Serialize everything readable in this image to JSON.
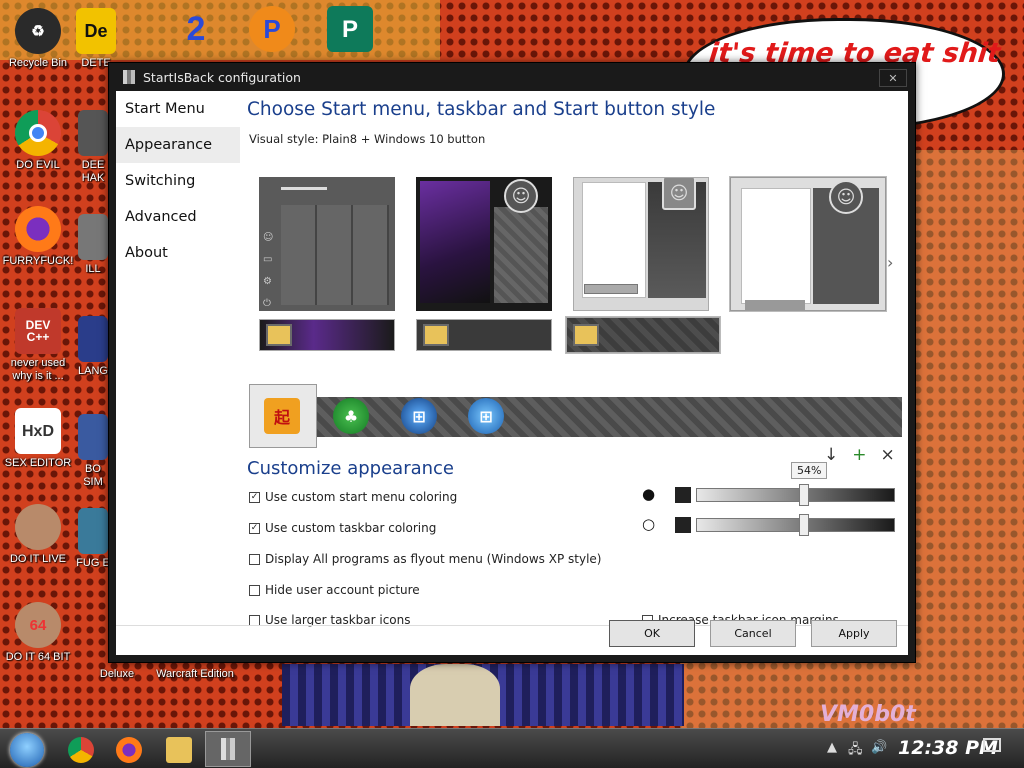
{
  "desktop": {
    "bubble_text": "it's time to eat shit ... ew",
    "signature": "VM0b0t",
    "icons": [
      {
        "label": "Recycle Bin"
      },
      {
        "label": "DO EVIL"
      },
      {
        "label": "FURRYFUCK!"
      },
      {
        "label": "never used why is it ..."
      },
      {
        "label": "SEX EDITOR"
      },
      {
        "label": "DO IT LIVE"
      },
      {
        "label": "DO IT 64 BIT"
      },
      {
        "label": "DETE"
      },
      {
        "label": "DEE HAK"
      },
      {
        "label": "ILL"
      },
      {
        "label": "LANG"
      },
      {
        "label": "BO SIM"
      },
      {
        "label": "FUG E"
      },
      {
        "label": "Deluxe"
      },
      {
        "label": "Warcraft Edition"
      }
    ]
  },
  "window": {
    "title": "StartIsBack configuration",
    "close_label": "✕",
    "nav": [
      "Start Menu",
      "Appearance",
      "Switching",
      "Advanced",
      "About"
    ],
    "heading": "Choose Start menu, taskbar and Start button style",
    "visual_style": "Visual style:  Plain8 + Windows 10 button",
    "customize_heading": "Customize appearance",
    "slider_tooltip": "54%",
    "checkboxes": [
      {
        "label": "Use custom start menu coloring",
        "checked": true
      },
      {
        "label": "Use custom taskbar coloring",
        "checked": true
      },
      {
        "label": "Display All programs as flyout menu (Windows XP style)",
        "checked": false
      },
      {
        "label": "Hide user account picture",
        "checked": false
      },
      {
        "label": "Use larger taskbar icons",
        "checked": false
      },
      {
        "label": "Increase taskbar icon margins",
        "checked": false
      }
    ],
    "buttons": {
      "ok": "OK",
      "cancel": "Cancel",
      "apply": "Apply"
    },
    "opacity_start_menu": 0.54,
    "opacity_taskbar": 0.54
  },
  "taskbar": {
    "time": "12:38 PM"
  }
}
